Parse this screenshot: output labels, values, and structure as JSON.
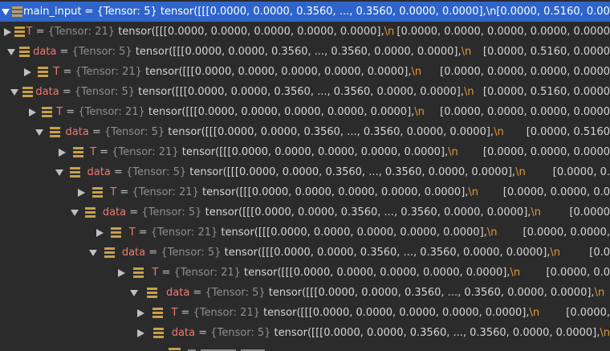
{
  "colors": {
    "background": "#2b2b2b",
    "selection": "#2f65ca",
    "name": "#ef7a73",
    "type": "#8f8f8f",
    "newline_escape": "#e49a3a",
    "icon": "#c8a04a"
  },
  "icons": {
    "expanded": "triangle-down-icon",
    "collapsed": "triangle-right-icon",
    "variable": "stack-icon"
  },
  "rows": [
    {
      "name": "main_input",
      "type": "{Tensor: 5}",
      "value": "tensor([[[0.0000, 0.0000, 0.3560,  ..., 0.3560, 0.0000, 0.0000],",
      "nl": "\\n",
      "tail": "[0.0000, 0.5160, 0.0000"
    },
    {
      "name": "T",
      "type": "{Tensor: 21}",
      "value": "tensor([[[0.0000, 0.0000, 0.0000, 0.0000, 0.0000],",
      "nl": "\\n",
      "tail": "[0.0000, 0.0000, 0.0000, 0.0000, 0.0000"
    },
    {
      "name": "data",
      "type": "{Tensor: 5}",
      "value": "tensor([[[0.0000, 0.0000, 0.3560,  ..., 0.3560, 0.0000, 0.0000],",
      "nl": "\\n",
      "tail": "[0.0000, 0.5160, 0.0000"
    },
    {
      "name": "T",
      "type": "{Tensor: 21}",
      "value": "tensor([[[0.0000, 0.0000, 0.0000, 0.0000, 0.0000],",
      "nl": "\\n",
      "tail": "[0.0000, 0.0000, 0.0000, 0.0000"
    },
    {
      "name": "data",
      "type": "{Tensor: 5}",
      "value": "tensor([[[0.0000, 0.0000, 0.3560,  ..., 0.3560, 0.0000, 0.0000],",
      "nl": "\\n",
      "tail": "[0.0000, 0.5160, 0.0000"
    },
    {
      "name": "T",
      "type": "{Tensor: 21}",
      "value": "tensor([[[0.0000, 0.0000, 0.0000, 0.0000, 0.0000],",
      "nl": "\\n",
      "tail": "[0.0000, 0.0000, 0.0000, 0.0000"
    },
    {
      "name": "data",
      "type": "{Tensor: 5}",
      "value": "tensor([[[0.0000, 0.0000, 0.3560,  ..., 0.3560, 0.0000, 0.0000],",
      "nl": "\\n",
      "tail": "[0.0000, 0.5160"
    },
    {
      "name": "T",
      "type": "{Tensor: 21}",
      "value": "tensor([[[0.0000, 0.0000, 0.0000, 0.0000, 0.0000],",
      "nl": "\\n",
      "tail": "[0.0000, 0.0000, 0.0000"
    },
    {
      "name": "data",
      "type": "{Tensor: 5}",
      "value": "tensor([[[0.0000, 0.0000, 0.3560,  ..., 0.3560, 0.0000, 0.0000],",
      "nl": "\\n",
      "tail": "[0.0000, 0."
    },
    {
      "name": "T",
      "type": "{Tensor: 21}",
      "value": "tensor([[[0.0000, 0.0000, 0.0000, 0.0000, 0.0000],",
      "nl": "\\n",
      "tail": "[0.0000, 0.0000, 0.0"
    },
    {
      "name": "data",
      "type": "{Tensor: 5}",
      "value": "tensor([[[0.0000, 0.0000, 0.3560,  ..., 0.3560, 0.0000, 0.0000],",
      "nl": "\\n",
      "tail": "[0.0000"
    },
    {
      "name": "T",
      "type": "{Tensor: 21}",
      "value": "tensor([[[0.0000, 0.0000, 0.0000, 0.0000, 0.0000],",
      "nl": "\\n",
      "tail": "[0.0000, 0.0000,"
    },
    {
      "name": "data",
      "type": "{Tensor: 5}",
      "value": "tensor([[[0.0000, 0.0000, 0.3560,  ..., 0.3560, 0.0000, 0.0000],",
      "nl": "\\n",
      "tail": "[0.0"
    },
    {
      "name": "T",
      "type": "{Tensor: 21}",
      "value": "tensor([[[0.0000, 0.0000, 0.0000, 0.0000, 0.0000],",
      "nl": "\\n",
      "tail": "[0.0000, 0.0"
    },
    {
      "name": "data",
      "type": "{Tensor: 5}",
      "value": "tensor([[[0.0000, 0.0000, 0.3560,  ..., 0.3560, 0.0000, 0.0000],",
      "nl": "\\n",
      "tail": ""
    },
    {
      "name": "T",
      "type": "{Tensor: 21}",
      "value": "tensor([[[0.0000, 0.0000, 0.0000, 0.0000, 0.0000],",
      "nl": "\\n",
      "tail": "[0.0000,"
    },
    {
      "name": "data",
      "type": "{Tensor: 5}",
      "value": "tensor([[[0.0000, 0.0000, 0.3560,  ..., 0.3560, 0.0000, 0.0000],",
      "nl": "\\n",
      "tail": ""
    }
  ]
}
